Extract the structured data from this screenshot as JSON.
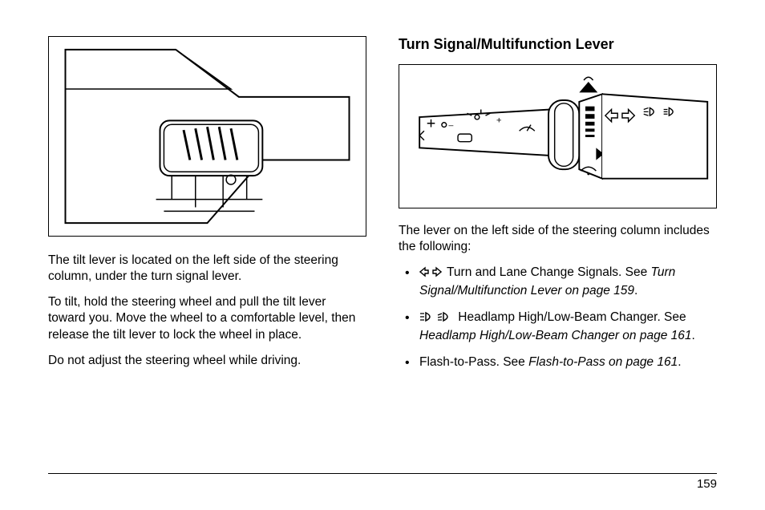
{
  "left": {
    "para1": "The tilt lever is located on the left side of the steering column, under the turn signal lever.",
    "para2": "To tilt, hold the steering wheel and pull the tilt lever toward you. Move the wheel to a comfortable level, then release the tilt lever to lock the wheel in place.",
    "para3": "Do not adjust the steering wheel while driving."
  },
  "right": {
    "heading": "Turn Signal/Multifunction Lever",
    "intro": "The lever on the left side of the steering column includes the following:",
    "items": [
      {
        "icon": "turn-signal",
        "text": " Turn and Lane Change Signals. See ",
        "ref": "Turn Signal/Multifunction Lever on page 159",
        "tail": "."
      },
      {
        "icon": "beam",
        "text": " Headlamp High/Low-Beam Changer. See ",
        "ref": "Headlamp High/Low-Beam Changer on page 161",
        "tail": "."
      },
      {
        "icon": "",
        "text": "Flash-to-Pass. See ",
        "ref": "Flash-to-Pass on page 161",
        "tail": "."
      }
    ]
  },
  "page_number": "159"
}
